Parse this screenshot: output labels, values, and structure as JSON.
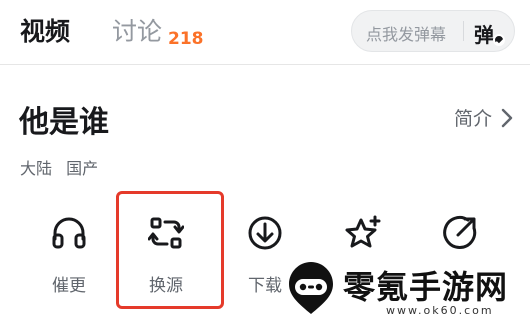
{
  "tabs": {
    "video": "视频",
    "discuss": "讨论",
    "discuss_count": "218"
  },
  "danmaku": {
    "placeholder": "点我发弹幕",
    "toggle_glyph": "弹"
  },
  "show": {
    "title": "他是谁",
    "intro_label": "简介",
    "tags": [
      "大陆",
      "国产"
    ]
  },
  "actions": [
    {
      "label": "催更",
      "icon": "headphones-icon"
    },
    {
      "label": "换源",
      "icon": "switch-source-icon"
    },
    {
      "label": "下载",
      "icon": "download-icon"
    },
    {
      "label": "",
      "icon": "star-plus-icon"
    },
    {
      "label": "",
      "icon": "share-icon"
    }
  ],
  "watermark": {
    "text": "零氪手游网",
    "url": "www.ok60.com"
  },
  "colors": {
    "accent_orange": "#fb7229",
    "highlight_red": "#e53a2a",
    "text_primary": "#18191c",
    "text_secondary": "#61666d"
  }
}
